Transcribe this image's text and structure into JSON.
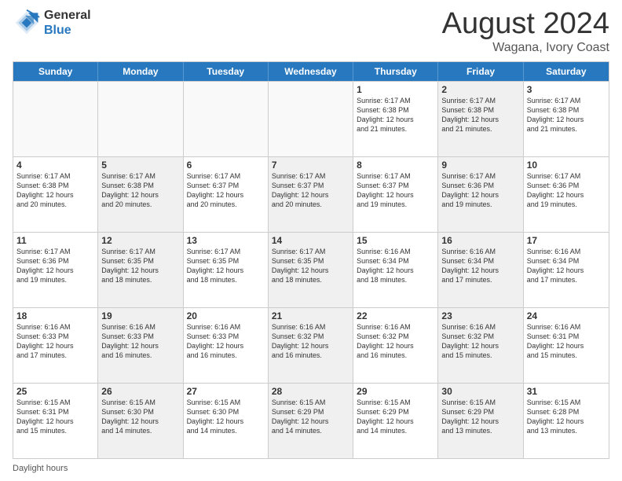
{
  "header": {
    "title": "August 2024",
    "location": "Wagana, Ivory Coast",
    "logo_line1": "General",
    "logo_line2": "Blue"
  },
  "days_of_week": [
    "Sunday",
    "Monday",
    "Tuesday",
    "Wednesday",
    "Thursday",
    "Friday",
    "Saturday"
  ],
  "footer": "Daylight hours",
  "weeks": [
    [
      {
        "day": "",
        "info": "",
        "empty": true
      },
      {
        "day": "",
        "info": "",
        "empty": true
      },
      {
        "day": "",
        "info": "",
        "empty": true
      },
      {
        "day": "",
        "info": "",
        "empty": true
      },
      {
        "day": "1",
        "info": "Sunrise: 6:17 AM\nSunset: 6:38 PM\nDaylight: 12 hours\nand 21 minutes.",
        "empty": false
      },
      {
        "day": "2",
        "info": "Sunrise: 6:17 AM\nSunset: 6:38 PM\nDaylight: 12 hours\nand 21 minutes.",
        "empty": false,
        "shaded": true
      },
      {
        "day": "3",
        "info": "Sunrise: 6:17 AM\nSunset: 6:38 PM\nDaylight: 12 hours\nand 21 minutes.",
        "empty": false
      }
    ],
    [
      {
        "day": "4",
        "info": "Sunrise: 6:17 AM\nSunset: 6:38 PM\nDaylight: 12 hours\nand 20 minutes.",
        "empty": false
      },
      {
        "day": "5",
        "info": "Sunrise: 6:17 AM\nSunset: 6:38 PM\nDaylight: 12 hours\nand 20 minutes.",
        "empty": false,
        "shaded": true
      },
      {
        "day": "6",
        "info": "Sunrise: 6:17 AM\nSunset: 6:37 PM\nDaylight: 12 hours\nand 20 minutes.",
        "empty": false
      },
      {
        "day": "7",
        "info": "Sunrise: 6:17 AM\nSunset: 6:37 PM\nDaylight: 12 hours\nand 20 minutes.",
        "empty": false,
        "shaded": true
      },
      {
        "day": "8",
        "info": "Sunrise: 6:17 AM\nSunset: 6:37 PM\nDaylight: 12 hours\nand 19 minutes.",
        "empty": false
      },
      {
        "day": "9",
        "info": "Sunrise: 6:17 AM\nSunset: 6:36 PM\nDaylight: 12 hours\nand 19 minutes.",
        "empty": false,
        "shaded": true
      },
      {
        "day": "10",
        "info": "Sunrise: 6:17 AM\nSunset: 6:36 PM\nDaylight: 12 hours\nand 19 minutes.",
        "empty": false
      }
    ],
    [
      {
        "day": "11",
        "info": "Sunrise: 6:17 AM\nSunset: 6:36 PM\nDaylight: 12 hours\nand 19 minutes.",
        "empty": false
      },
      {
        "day": "12",
        "info": "Sunrise: 6:17 AM\nSunset: 6:35 PM\nDaylight: 12 hours\nand 18 minutes.",
        "empty": false,
        "shaded": true
      },
      {
        "day": "13",
        "info": "Sunrise: 6:17 AM\nSunset: 6:35 PM\nDaylight: 12 hours\nand 18 minutes.",
        "empty": false
      },
      {
        "day": "14",
        "info": "Sunrise: 6:17 AM\nSunset: 6:35 PM\nDaylight: 12 hours\nand 18 minutes.",
        "empty": false,
        "shaded": true
      },
      {
        "day": "15",
        "info": "Sunrise: 6:16 AM\nSunset: 6:34 PM\nDaylight: 12 hours\nand 18 minutes.",
        "empty": false
      },
      {
        "day": "16",
        "info": "Sunrise: 6:16 AM\nSunset: 6:34 PM\nDaylight: 12 hours\nand 17 minutes.",
        "empty": false,
        "shaded": true
      },
      {
        "day": "17",
        "info": "Sunrise: 6:16 AM\nSunset: 6:34 PM\nDaylight: 12 hours\nand 17 minutes.",
        "empty": false
      }
    ],
    [
      {
        "day": "18",
        "info": "Sunrise: 6:16 AM\nSunset: 6:33 PM\nDaylight: 12 hours\nand 17 minutes.",
        "empty": false
      },
      {
        "day": "19",
        "info": "Sunrise: 6:16 AM\nSunset: 6:33 PM\nDaylight: 12 hours\nand 16 minutes.",
        "empty": false,
        "shaded": true
      },
      {
        "day": "20",
        "info": "Sunrise: 6:16 AM\nSunset: 6:33 PM\nDaylight: 12 hours\nand 16 minutes.",
        "empty": false
      },
      {
        "day": "21",
        "info": "Sunrise: 6:16 AM\nSunset: 6:32 PM\nDaylight: 12 hours\nand 16 minutes.",
        "empty": false,
        "shaded": true
      },
      {
        "day": "22",
        "info": "Sunrise: 6:16 AM\nSunset: 6:32 PM\nDaylight: 12 hours\nand 16 minutes.",
        "empty": false
      },
      {
        "day": "23",
        "info": "Sunrise: 6:16 AM\nSunset: 6:32 PM\nDaylight: 12 hours\nand 15 minutes.",
        "empty": false,
        "shaded": true
      },
      {
        "day": "24",
        "info": "Sunrise: 6:16 AM\nSunset: 6:31 PM\nDaylight: 12 hours\nand 15 minutes.",
        "empty": false
      }
    ],
    [
      {
        "day": "25",
        "info": "Sunrise: 6:15 AM\nSunset: 6:31 PM\nDaylight: 12 hours\nand 15 minutes.",
        "empty": false
      },
      {
        "day": "26",
        "info": "Sunrise: 6:15 AM\nSunset: 6:30 PM\nDaylight: 12 hours\nand 14 minutes.",
        "empty": false,
        "shaded": true
      },
      {
        "day": "27",
        "info": "Sunrise: 6:15 AM\nSunset: 6:30 PM\nDaylight: 12 hours\nand 14 minutes.",
        "empty": false
      },
      {
        "day": "28",
        "info": "Sunrise: 6:15 AM\nSunset: 6:29 PM\nDaylight: 12 hours\nand 14 minutes.",
        "empty": false,
        "shaded": true
      },
      {
        "day": "29",
        "info": "Sunrise: 6:15 AM\nSunset: 6:29 PM\nDaylight: 12 hours\nand 14 minutes.",
        "empty": false
      },
      {
        "day": "30",
        "info": "Sunrise: 6:15 AM\nSunset: 6:29 PM\nDaylight: 12 hours\nand 13 minutes.",
        "empty": false,
        "shaded": true
      },
      {
        "day": "31",
        "info": "Sunrise: 6:15 AM\nSunset: 6:28 PM\nDaylight: 12 hours\nand 13 minutes.",
        "empty": false
      }
    ]
  ]
}
